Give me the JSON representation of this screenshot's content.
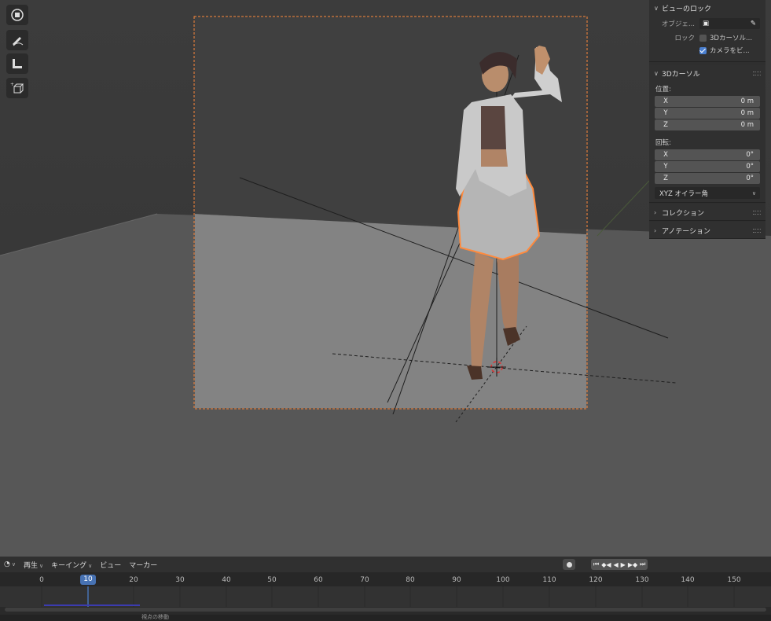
{
  "viewport": {
    "tools": [
      {
        "icon": "cursor-icon"
      },
      {
        "icon": "annotate-icon"
      },
      {
        "icon": "measure-icon"
      },
      {
        "icon": "add-cube-icon"
      }
    ]
  },
  "npanel": {
    "view_lock": {
      "title": "ビューのロック",
      "object_label": "オブジェ...",
      "lock_label": "ロック",
      "lock_3d_cursor": {
        "label": "3Dカーソル...",
        "checked": false
      },
      "lock_camera": {
        "label": "カメラをビ...",
        "checked": true
      }
    },
    "cursor_3d": {
      "title": "3Dカーソル",
      "location_label": "位置:",
      "location": [
        {
          "axis": "X",
          "value": "0 m"
        },
        {
          "axis": "Y",
          "value": "0 m"
        },
        {
          "axis": "Z",
          "value": "0 m"
        }
      ],
      "rotation_label": "回転:",
      "rotation": [
        {
          "axis": "X",
          "value": "0°"
        },
        {
          "axis": "Y",
          "value": "0°"
        },
        {
          "axis": "Z",
          "value": "0°"
        }
      ],
      "rotation_mode": "XYZ オイラー角"
    },
    "collection": {
      "title": "コレクション"
    },
    "annotation": {
      "title": "アノテーション"
    }
  },
  "timeline": {
    "menus": {
      "playback": "再生",
      "keying": "キーイング",
      "view": "ビュー",
      "marker": "マーカー"
    },
    "current_frame": "10",
    "ruler_ticks": [
      "0",
      "10",
      "20",
      "30",
      "40",
      "50",
      "60",
      "70",
      "80",
      "90",
      "100",
      "110",
      "120",
      "130",
      "140",
      "150"
    ],
    "transport": [
      "⏮",
      "◆◀",
      "◀",
      "▶",
      "▶◆",
      "⏭"
    ],
    "status_text": "視点の移動"
  },
  "colors": {
    "accent": "#4772b3",
    "selection": "#ff8a3d"
  }
}
